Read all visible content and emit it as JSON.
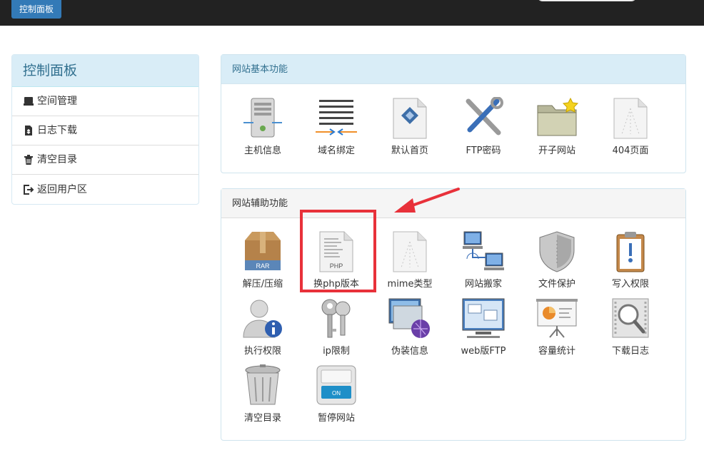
{
  "topbar": {
    "button_label": "控制面板"
  },
  "sidebar": {
    "title": "控制面板",
    "items": [
      {
        "label": "空间管理",
        "icon": "hdd-icon"
      },
      {
        "label": "日志下载",
        "icon": "file-download-icon"
      },
      {
        "label": "清空目录",
        "icon": "trash-icon"
      },
      {
        "label": "返回用户区",
        "icon": "logout-icon"
      }
    ]
  },
  "basic": {
    "title": "网站基本功能",
    "tiles": [
      {
        "label": "主机信息",
        "icon": "server-icon"
      },
      {
        "label": "域名绑定",
        "icon": "domain-bind-icon"
      },
      {
        "label": "默认首页",
        "icon": "default-page-icon"
      },
      {
        "label": "FTP密码",
        "icon": "tools-icon"
      },
      {
        "label": "开子网站",
        "icon": "folder-star-icon"
      },
      {
        "label": "404页面",
        "icon": "blank-page-icon"
      }
    ]
  },
  "aux": {
    "title": "网站辅助功能",
    "tiles": [
      {
        "label": "解压/压缩",
        "icon": "rar-box-icon"
      },
      {
        "label": "换php版本",
        "icon": "php-file-icon"
      },
      {
        "label": "mime类型",
        "icon": "mime-file-icon"
      },
      {
        "label": "网站搬家",
        "icon": "network-computers-icon"
      },
      {
        "label": "文件保护",
        "icon": "shield-icon"
      },
      {
        "label": "写入权限",
        "icon": "clipboard-alert-icon"
      },
      {
        "label": "执行权限",
        "icon": "user-info-icon"
      },
      {
        "label": "ip限制",
        "icon": "keys-icon"
      },
      {
        "label": "伪装信息",
        "icon": "monitor-globe-icon"
      },
      {
        "label": "web版FTP",
        "icon": "web-ftp-icon"
      },
      {
        "label": "容量统计",
        "icon": "presentation-chart-icon"
      },
      {
        "label": "下载日志",
        "icon": "magnifier-film-icon"
      },
      {
        "label": "清空目录",
        "icon": "trash-can-icon"
      },
      {
        "label": "暂停网站",
        "icon": "switch-on-icon"
      }
    ]
  },
  "switch_text": "ON",
  "php_text": "PHP",
  "rar_text": "RAR",
  "colors": {
    "accent": "#337ab7",
    "annotation": "#e8313a",
    "panel_head": "#d9edf7"
  }
}
